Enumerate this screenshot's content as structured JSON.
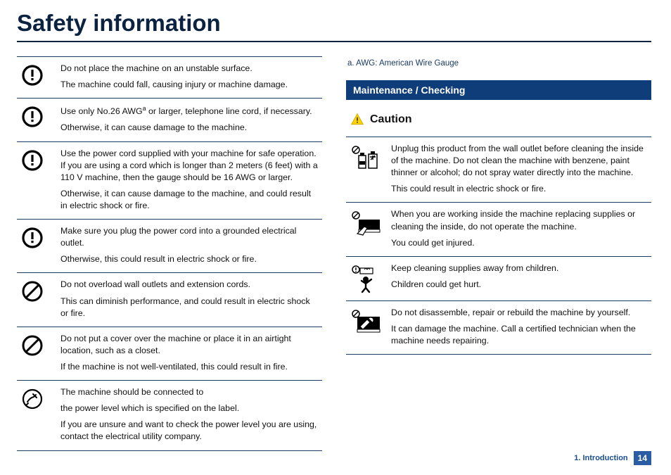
{
  "title": "Safety information",
  "footnote": "a.  AWG: American Wire Gauge",
  "section_header": "Maintenance / Checking",
  "caution_label": "Caution",
  "chapter_label": "1. Introduction",
  "page_number": "14",
  "left_rows": [
    {
      "icon": "exclaim",
      "paras": [
        "Do not place the machine on an unstable surface.",
        "The machine could fall, causing injury or machine damage."
      ]
    },
    {
      "icon": "exclaim",
      "paras": [
        "Use only No.26 AWG{SUP_A} or larger, telephone line cord, if necessary.",
        "Otherwise, it can cause damage to the machine."
      ]
    },
    {
      "icon": "exclaim",
      "paras": [
        "Use the power cord supplied with your machine for safe operation. If you are using a cord which is longer than 2 meters (6 feet) with a 110 V machine, then the gauge should be 16 AWG or larger.",
        "Otherwise, it can cause damage to the machine, and could result in electric shock or fire."
      ]
    },
    {
      "icon": "exclaim",
      "paras": [
        "Make sure you plug the power cord into a grounded electrical outlet.",
        "Otherwise, this could result in electric shock or fire."
      ]
    },
    {
      "icon": "prohibit",
      "paras": [
        "Do not overload wall outlets and extension cords.",
        "This can diminish performance, and could result in electric shock or fire."
      ]
    },
    {
      "icon": "prohibit",
      "paras": [
        "Do not put a cover over the machine or place it in an airtight location, such as a closet.",
        "If the machine is not well-ventilated, this could result in fire."
      ]
    },
    {
      "icon": "plug",
      "paras": [
        "The machine should be connected to",
        "the power level which is specified on the label.",
        "If you are unsure and want to check the power level you are using, contact the electrical utility company."
      ]
    }
  ],
  "right_rows": [
    {
      "picto": "bottles",
      "paras": [
        "Unplug this product from the wall outlet before cleaning the inside of the machine. Do not clean the machine with benzene, paint thinner or alcohol; do not spray water directly into the machine.",
        "This could result in electric shock or fire."
      ]
    },
    {
      "picto": "hand_machine",
      "paras": [
        "When you are working inside the machine replacing supplies or cleaning the inside, do not operate the machine.",
        "You could get injured."
      ]
    },
    {
      "picto": "child",
      "paras": [
        "Keep cleaning supplies away from children.",
        "Children could get hurt."
      ]
    },
    {
      "picto": "tool",
      "paras": [
        "Do not disassemble, repair or rebuild the machine by yourself.",
        "It can damage the machine. Call a certified technician when the machine needs repairing."
      ]
    }
  ]
}
